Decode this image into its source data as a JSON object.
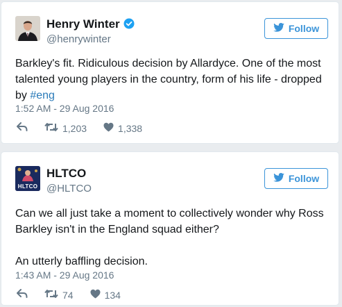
{
  "tweets": [
    {
      "name": "Henry Winter",
      "handle": "@henrywinter",
      "verified": true,
      "follow_label": "Follow",
      "text_before": "Barkley's fit. Ridiculous decision by Allardyce. One of the most talented young players in the country, form of his life - dropped by ",
      "hashtag": "#eng",
      "timestamp": "1:52 AM - 29 Aug 2016",
      "retweets": "1,203",
      "likes": "1,338"
    },
    {
      "name": "HLTCO",
      "handle": "@HLTCO",
      "verified": false,
      "avatar_text": "HLTCO",
      "follow_label": "Follow",
      "text_para1": "Can we all just take a moment to collectively wonder why Ross Barkley isn't in the England squad either?",
      "text_para2": "An utterly baffling decision.",
      "timestamp": "1:43 AM - 29 Aug 2016",
      "retweets": "74",
      "likes": "134"
    }
  ],
  "colors": {
    "link": "#2b7bb9",
    "follow": "#3b94d9",
    "muted": "#657786",
    "verified": "#1da1f2"
  },
  "icons": [
    "reply-icon",
    "retweet-icon",
    "heart-icon",
    "twitter-bird-icon",
    "verified-badge-icon"
  ]
}
